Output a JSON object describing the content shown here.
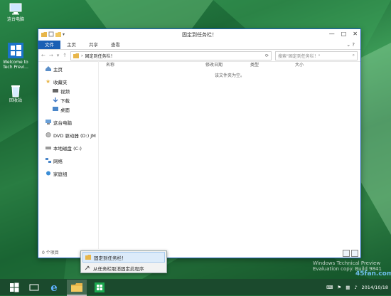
{
  "desktop": {
    "icons": [
      {
        "label": "这台电脑",
        "icon": "computer-icon"
      },
      {
        "label": "Welcome to Tech Previ...",
        "icon": "windows-logo-icon"
      },
      {
        "label": "回收站",
        "icon": "recycle-bin-icon"
      }
    ]
  },
  "window": {
    "title": "固定到任务栏！",
    "ribbon_tabs": [
      "文件",
      "主页",
      "共享",
      "查看"
    ],
    "address": {
      "path": "固定到任务栏！",
      "search_placeholder": "搜索\"固定到任务栏！\""
    },
    "nav_pane": {
      "home": "主页",
      "favorites": "收藏夹",
      "fav_items": [
        "视频",
        "下载",
        "桌面"
      ],
      "this_pc": "这台电脑",
      "dvd": "DVD 驱动器 (D:) JM",
      "local_disk": "本地磁盘 (C:)",
      "network": "网络",
      "homegroup": "家庭组"
    },
    "columns": [
      "名称",
      "修改日期",
      "类型",
      "大小"
    ],
    "empty_message": "该文件夹为空。",
    "status": "0 个项目"
  },
  "jump_list": {
    "items": [
      "固定到任务栏！",
      "从任务栏取消固定此程序"
    ]
  },
  "taskbar": {
    "buttons": [
      "start-button",
      "ie-icon",
      "file-explorer-icon",
      "store-icon"
    ],
    "clock_time": "",
    "clock_date": "2014/10/18"
  },
  "watermark": {
    "line1": "Windows Technical Preview",
    "line2": "Evaluation copy. Build 9841",
    "site": "45fan.com"
  },
  "colors": {
    "accent": "#1a5fb4",
    "taskbar": "#1b4a2d",
    "wallpaper": "#1f6e3a"
  }
}
